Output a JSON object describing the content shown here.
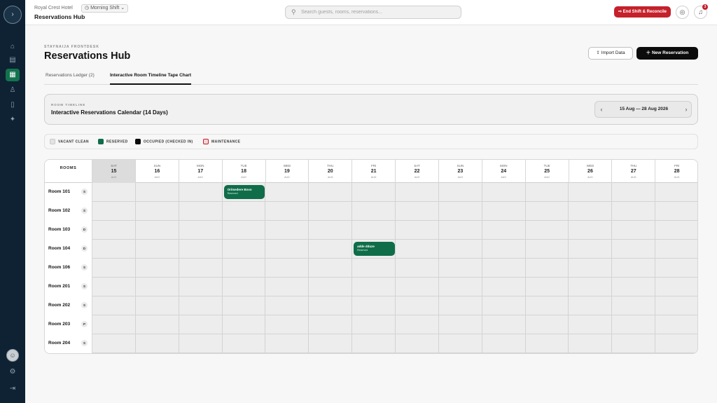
{
  "topbar": {
    "hotel_name": "Royal Crest Hotel",
    "shift_label": "Morning Shift",
    "breadcrumb_title": "Reservations Hub",
    "search_placeholder": "Search guests, rooms, reservations...",
    "end_shift_label": "End Shift & Reconcile",
    "notification_count": "3"
  },
  "page": {
    "eyebrow": "STAYNAIJA FRONTDESK",
    "title": "Reservations Hub",
    "import_label": "Import Data",
    "new_label": "New Reservation"
  },
  "tabs": [
    {
      "label": "Reservations Ledger (2)",
      "active": false
    },
    {
      "label": "Interactive Room Timeline Tape Chart",
      "active": true
    }
  ],
  "timeline": {
    "eyebrow": "ROOM TIMELINE",
    "title": "Interactive Reservations Calendar (14 Days)",
    "range": "15 Aug — 28 Aug 2026"
  },
  "legend": [
    {
      "label": "VACANT CLEAN",
      "color": "#e3e3e3"
    },
    {
      "label": "RESERVED",
      "color": "#0f6d4a"
    },
    {
      "label": "OCCUPIED (CHECKED IN)",
      "color": "#0c0c0c"
    },
    {
      "label": "MAINTENANCE",
      "color": "#f5d6d6"
    }
  ],
  "grid": {
    "rooms_header": "ROOMS",
    "days": [
      {
        "dow": "SAT",
        "num": "15",
        "mon": "AUG",
        "today": true
      },
      {
        "dow": "SUN",
        "num": "16",
        "mon": "AUG"
      },
      {
        "dow": "MON",
        "num": "17",
        "mon": "AUG"
      },
      {
        "dow": "TUE",
        "num": "18",
        "mon": "AUG"
      },
      {
        "dow": "WED",
        "num": "19",
        "mon": "AUG"
      },
      {
        "dow": "THU",
        "num": "20",
        "mon": "AUG"
      },
      {
        "dow": "FRI",
        "num": "21",
        "mon": "AUG"
      },
      {
        "dow": "SAT",
        "num": "22",
        "mon": "AUG"
      },
      {
        "dow": "SUN",
        "num": "23",
        "mon": "AUG"
      },
      {
        "dow": "MON",
        "num": "24",
        "mon": "AUG"
      },
      {
        "dow": "TUE",
        "num": "25",
        "mon": "AUG"
      },
      {
        "dow": "WED",
        "num": "26",
        "mon": "AUG"
      },
      {
        "dow": "THU",
        "num": "27",
        "mon": "AUG"
      },
      {
        "dow": "FRI",
        "num": "28",
        "mon": "AUG"
      }
    ],
    "rooms": [
      {
        "name": "Room 101",
        "code": "S"
      },
      {
        "name": "Room 102",
        "code": "S"
      },
      {
        "name": "Room 103",
        "code": "D"
      },
      {
        "name": "Room 104",
        "code": "D"
      },
      {
        "name": "Room 106",
        "code": "S"
      },
      {
        "name": "Room 201",
        "code": "S"
      },
      {
        "name": "Room 202",
        "code": "S"
      },
      {
        "name": "Room 203",
        "code": "P"
      },
      {
        "name": "Room 204",
        "code": "S"
      }
    ],
    "bookings": [
      {
        "room_index": 0,
        "day_index": 3,
        "nights": 1,
        "guest": "Oritsedere Bovo",
        "status": "Reserved"
      },
      {
        "room_index": 3,
        "day_index": 6,
        "nights": 1,
        "guest": "adde dduze",
        "status": "Reserved"
      }
    ]
  }
}
